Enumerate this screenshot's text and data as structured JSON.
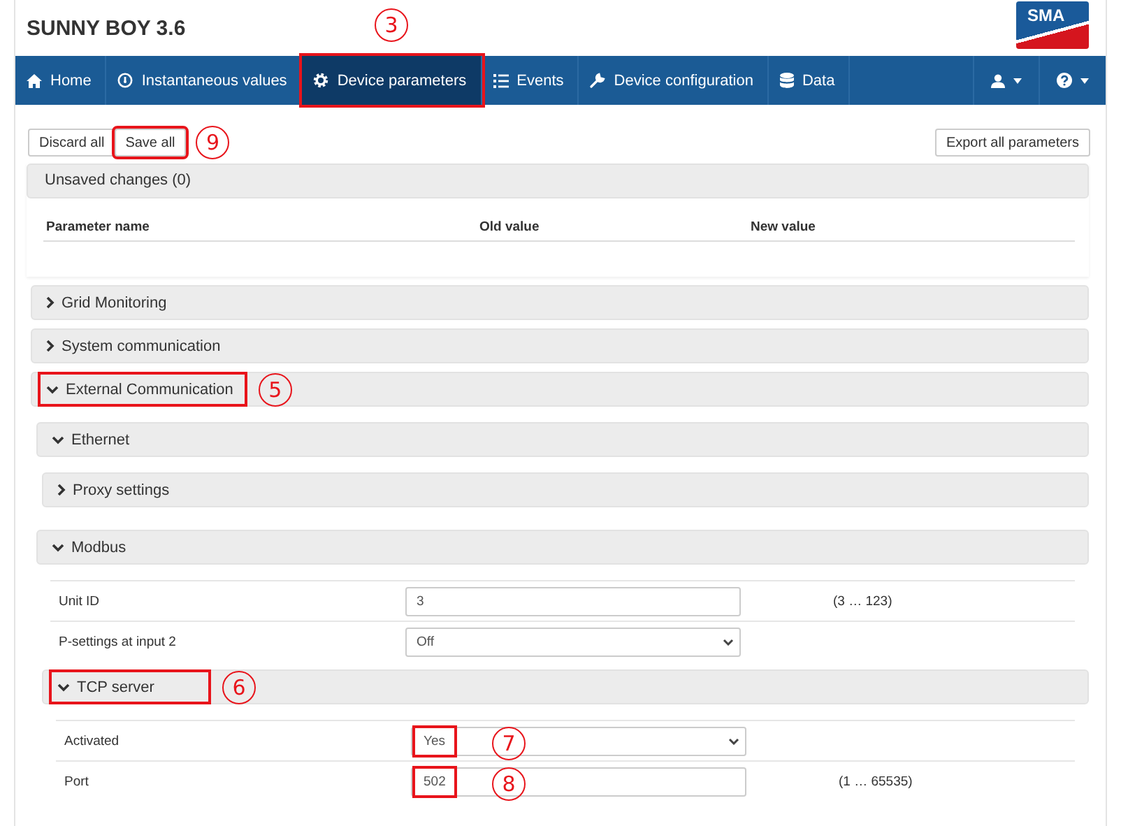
{
  "header": {
    "title": "SUNNY BOY 3.6",
    "logo": "SMA"
  },
  "nav": {
    "tabs": [
      {
        "label": "Home",
        "selected": false
      },
      {
        "label": "Instantaneous values",
        "selected": false
      },
      {
        "label": "Device parameters",
        "selected": true,
        "callout": "3"
      },
      {
        "label": "Events",
        "selected": false
      },
      {
        "label": "Device configuration",
        "selected": false
      },
      {
        "label": "Data",
        "selected": false
      }
    ]
  },
  "toolbar": {
    "buttons": [
      {
        "label": "Discard all"
      },
      {
        "label": "Save all",
        "callout": "9"
      }
    ],
    "export": "Export all parameters"
  },
  "unsaved": {
    "title": "Unsaved changes (0)",
    "columns": [
      "Parameter name",
      "Old value",
      "New value"
    ]
  },
  "groups": [
    {
      "label": "Grid Monitoring",
      "expanded": false
    },
    {
      "label": "System communication",
      "expanded": false
    },
    {
      "label": "External Communication",
      "expanded": true,
      "callout": "5",
      "children": [
        {
          "kind": "group",
          "label": "Ethernet",
          "expanded": true,
          "children": [
            {
              "kind": "group",
              "label": "Proxy settings",
              "expanded": false
            }
          ]
        },
        {
          "kind": "group",
          "label": "Modbus",
          "expanded": true,
          "children": [
            {
              "kind": "text",
              "label": "Unit ID",
              "value": "3",
              "range": "(3 … 123)"
            },
            {
              "kind": "select",
              "label": "P-settings at input 2",
              "value": "Off"
            },
            {
              "kind": "group",
              "label": "TCP server",
              "expanded": true,
              "callout": "6",
              "children": [
                {
                  "kind": "select",
                  "label": "Activated",
                  "value": "Yes",
                  "callout": "7"
                },
                {
                  "kind": "text",
                  "label": "Port",
                  "value": "502",
                  "range": "(1 … 65535)",
                  "callout": "8"
                }
              ]
            }
          ]
        }
      ]
    }
  ]
}
